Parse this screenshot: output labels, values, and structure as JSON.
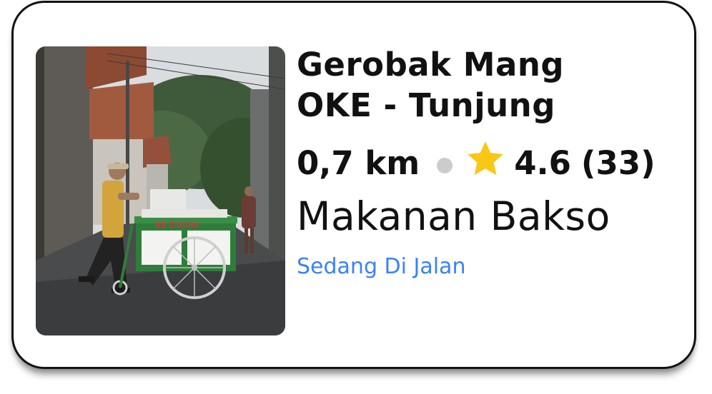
{
  "card": {
    "image_alt": "Street vendor pushing a cart",
    "cart_sign": "ES CINCAU",
    "title_line1": "Gerobak Mang",
    "title_line2": "OKE - Tunjung",
    "distance": "0,7 km",
    "rating": "4.6",
    "review_count": "(33)",
    "category": "Makanan Bakso",
    "status": "Sedang Di Jalan",
    "icons": {
      "separator": "dot-icon",
      "rating": "star-icon"
    },
    "colors": {
      "star": "#f9c715",
      "status": "#3b82f6",
      "dot": "#cccccc"
    }
  }
}
